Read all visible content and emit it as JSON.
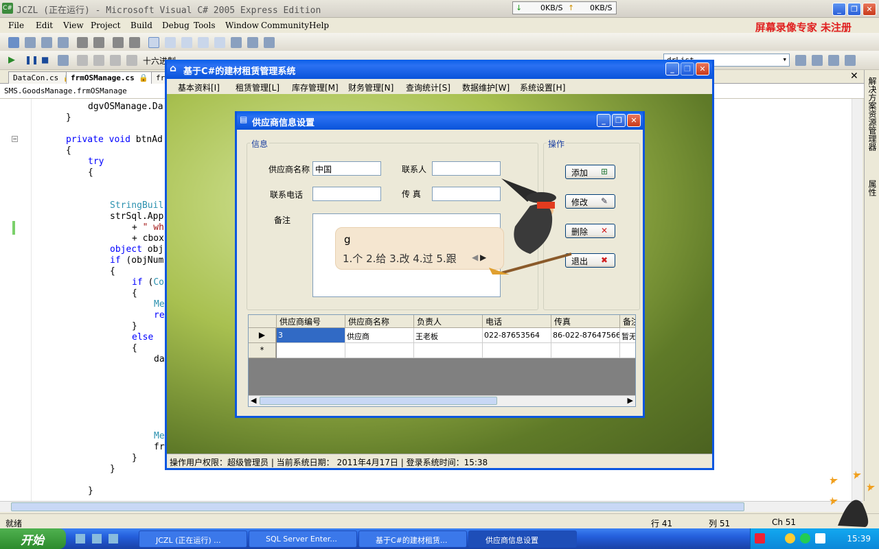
{
  "vs": {
    "title": "JCZL (正在运行) - Microsoft Visual C# 2005 Express Edition",
    "net_down": "0KB/S",
    "net_up": "0KB/S",
    "menu": [
      "File",
      "Edit",
      "View",
      "Project",
      "Build",
      "Debug",
      "Tools",
      "Window",
      "Community",
      "Help"
    ],
    "watermark": "屏幕录像专家 未注册",
    "hex_label": "十六进制",
    "toolbar_combo": "drList",
    "tabs": [
      "DataCon.cs",
      "frmOSManage.cs",
      "fr"
    ],
    "breadcrumb": "SMS.GoodsManage.frmOSManage",
    "side_labels": [
      "解决方案资源管理器",
      "属性"
    ],
    "code_lines": [
      {
        "indent": 128,
        "parts": [
          [
            "",
            "dgvOSManage.Da"
          ]
        ]
      },
      {
        "indent": 96,
        "parts": [
          [
            "",
            "}"
          ]
        ]
      },
      {
        "indent": 96,
        "parts": [
          [
            "kw",
            "private void"
          ],
          [
            "",
            " btnAd"
          ]
        ]
      },
      {
        "indent": 96,
        "parts": [
          [
            "",
            "{"
          ]
        ]
      },
      {
        "indent": 128,
        "parts": [
          [
            "kw",
            "try"
          ]
        ]
      },
      {
        "indent": 128,
        "parts": [
          [
            "",
            "{"
          ]
        ]
      },
      {
        "indent": 160,
        "parts": [
          [
            "ty",
            "StringBuil"
          ]
        ]
      },
      {
        "indent": 160,
        "parts": [
          [
            "",
            "strSql.App"
          ]
        ]
      },
      {
        "indent": 192,
        "parts": [
          [
            "",
            "+ "
          ],
          [
            "st",
            "\" wh"
          ]
        ]
      },
      {
        "indent": 192,
        "parts": [
          [
            "",
            "+ cbox"
          ]
        ]
      },
      {
        "indent": 160,
        "parts": [
          [
            "kw",
            "object"
          ],
          [
            "",
            " obj"
          ]
        ]
      },
      {
        "indent": 160,
        "parts": [
          [
            "kw",
            "if"
          ],
          [
            "",
            " (objNum"
          ]
        ]
      },
      {
        "indent": 160,
        "parts": [
          [
            "",
            "{"
          ]
        ]
      },
      {
        "indent": 192,
        "parts": [
          [
            "kw",
            "if"
          ],
          [
            "",
            " ("
          ],
          [
            "ty",
            "Co"
          ]
        ]
      },
      {
        "indent": 192,
        "parts": [
          [
            "",
            "{"
          ]
        ]
      },
      {
        "indent": 224,
        "parts": [
          [
            "ty",
            "Me"
          ]
        ]
      },
      {
        "indent": 224,
        "parts": [
          [
            "kw",
            "re"
          ]
        ]
      },
      {
        "indent": 192,
        "parts": [
          [
            "",
            "}"
          ]
        ]
      },
      {
        "indent": 192,
        "parts": [
          [
            "kw",
            "else"
          ]
        ]
      },
      {
        "indent": 192,
        "parts": [
          [
            "",
            "{"
          ]
        ]
      },
      {
        "indent": 224,
        "parts": [
          [
            "",
            "da"
          ]
        ]
      },
      {
        "indent": 224,
        "parts": [
          [
            "ty",
            "Me"
          ]
        ]
      },
      {
        "indent": 224,
        "parts": [
          [
            "",
            "fr"
          ]
        ]
      },
      {
        "indent": 192,
        "parts": [
          [
            "",
            "}"
          ]
        ]
      },
      {
        "indent": 160,
        "parts": [
          [
            "",
            "}"
          ]
        ]
      },
      {
        "indent": 128,
        "parts": [
          [
            "",
            "}"
          ]
        ]
      }
    ],
    "status_ready": "就绪",
    "status_row": "行 41",
    "status_col": "列 51",
    "status_ch": "Ch 51"
  },
  "app": {
    "title": "基于C#的建材租赁管理系统",
    "menu": [
      "基本资料[I]",
      "租赁管理[L]",
      "库存管理[M]",
      "财务管理[N]",
      "查询统计[S]",
      "数据维护[W]",
      "系统设置[H]"
    ],
    "status": "操作用户权限：超级管理员 | 当前系统日期： 2011年4月17日 | 登录系统时间：15:38"
  },
  "dialog": {
    "title": "供应商信息设置",
    "info_group": "信息",
    "ops_group": "操作",
    "fields": {
      "supplier_name_label": "供应商名称",
      "supplier_name_value": "中国",
      "contact_label": "联系人",
      "contact_value": "",
      "phone_label": "联系电话",
      "phone_value": "",
      "fax_label": "传 真",
      "fax_value": "",
      "remark_label": "备注",
      "remark_value": ""
    },
    "buttons": {
      "add": "添加",
      "edit": "修改",
      "delete": "删除",
      "exit": "退出"
    },
    "grid": {
      "columns": [
        "供应商编号",
        "供应商名称",
        "负责人",
        "电话",
        "传真",
        "备注"
      ],
      "rows": [
        [
          "3",
          "供应商",
          "王老板",
          "022-87653564",
          "86-022-87647566",
          "暂无"
        ]
      ],
      "new_row_marker": "*",
      "current_row_marker": "▶"
    }
  },
  "ime": {
    "input": "g",
    "candidates": "1.个  2.给  3.改  4.过  5.跟"
  },
  "taskbar": {
    "start": "开始",
    "tasks": [
      "JCZL (正在运行) ...",
      "SQL Server Enter...",
      "基于C#的建材租赁...",
      "供应商信息设置"
    ],
    "clock": "15:39"
  }
}
